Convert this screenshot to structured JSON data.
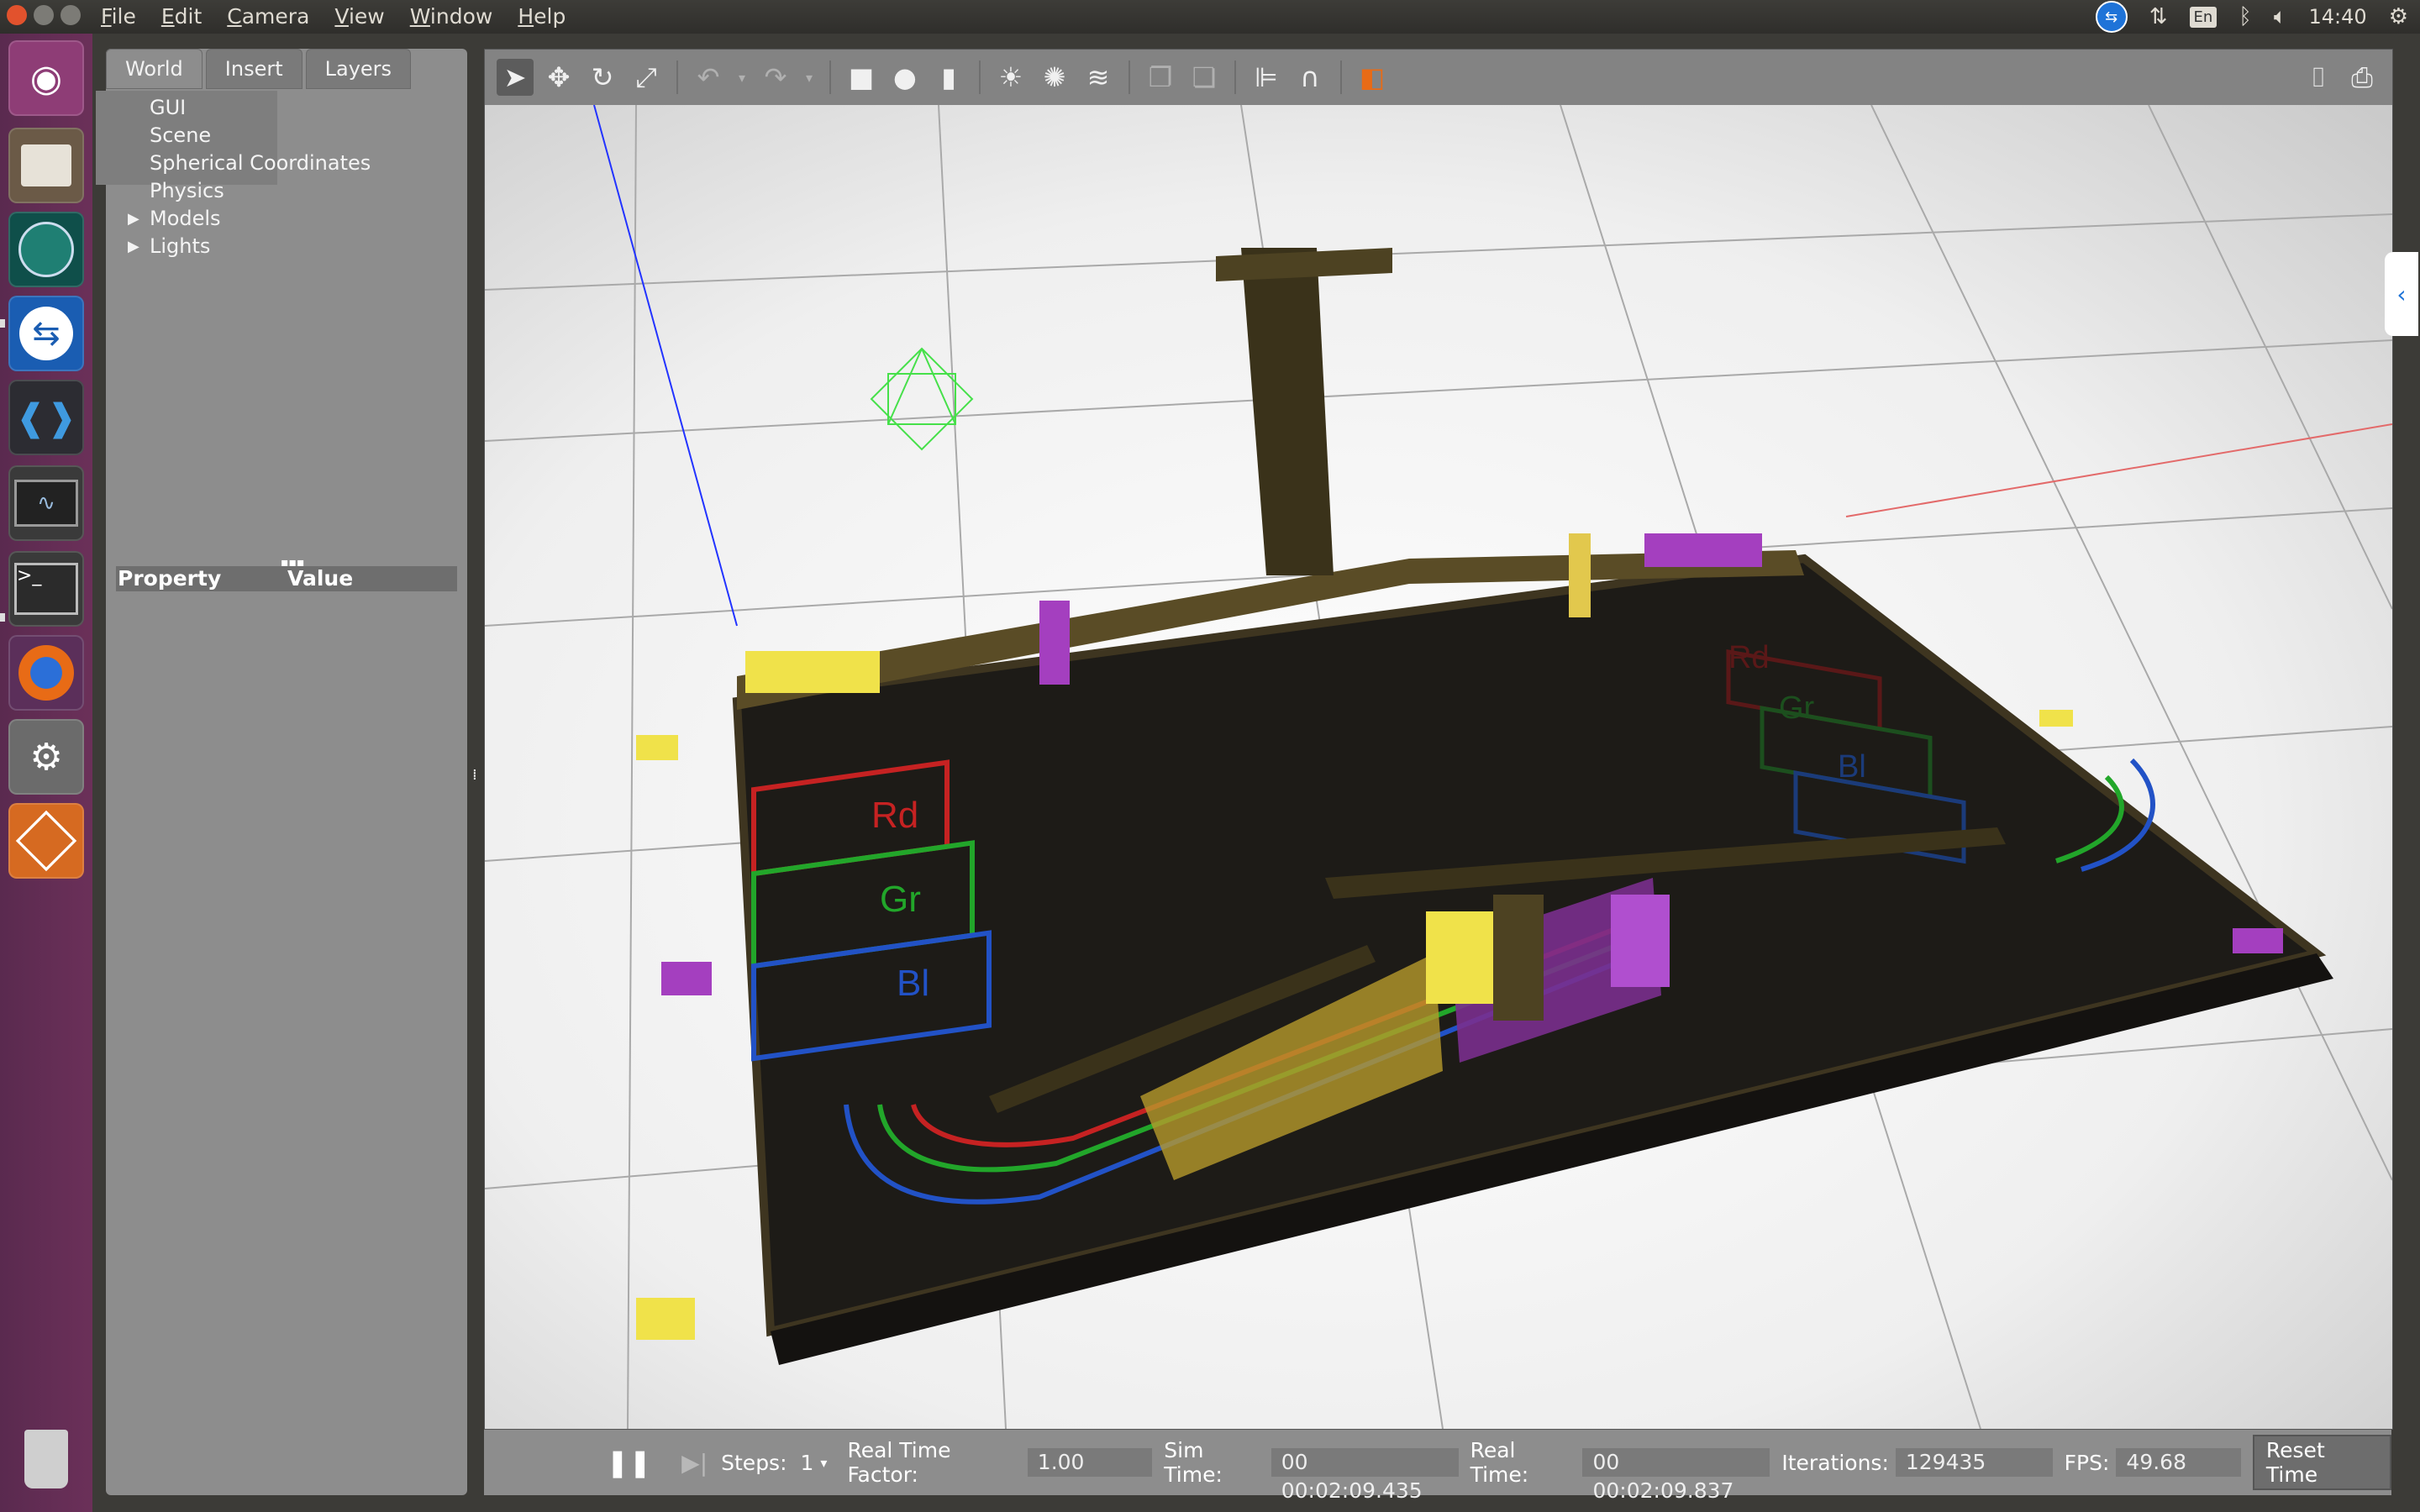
{
  "menubar": {
    "items": [
      {
        "label": "File",
        "key": "F",
        "rest": "ile"
      },
      {
        "label": "Edit",
        "key": "E",
        "rest": "dit"
      },
      {
        "label": "Camera",
        "key": "C",
        "rest": "amera"
      },
      {
        "label": "View",
        "key": "V",
        "rest": "iew"
      },
      {
        "label": "Window",
        "key": "W",
        "rest": "indow"
      },
      {
        "label": "Help",
        "key": "H",
        "rest": "elp"
      }
    ]
  },
  "tray": {
    "lang": "En",
    "time": "14:40"
  },
  "launcher": {
    "items": [
      "ubuntu-dash",
      "files",
      "gitkraken",
      "teamviewer",
      "vscode",
      "system-monitor",
      "terminal",
      "firefox",
      "system-settings",
      "gazebo"
    ]
  },
  "left_panel": {
    "tabs": [
      "World",
      "Insert",
      "Layers"
    ],
    "active_tab": "World",
    "tree": [
      {
        "label": "GUI",
        "expandable": false
      },
      {
        "label": "Scene",
        "expandable": false
      },
      {
        "label": "Spherical Coordinates",
        "expandable": false
      },
      {
        "label": "Physics",
        "expandable": false
      },
      {
        "label": "Models",
        "expandable": true
      },
      {
        "label": "Lights",
        "expandable": true
      }
    ],
    "property_header": {
      "property": "Property",
      "value": "Value"
    }
  },
  "scene_labels": {
    "left_red": "Rd",
    "left_green": "Gr",
    "left_blue": "Bl",
    "right_red": "Rd",
    "right_green": "Gr",
    "right_blue": "Bl"
  },
  "bottom_bar": {
    "steps_label": "Steps:",
    "steps_value": "1",
    "rtf_label": "Real Time Factor:",
    "rtf_value": "1.00",
    "sim_time_label": "Sim Time:",
    "sim_time_value": "00 00:02:09.435",
    "real_time_label": "Real Time:",
    "real_time_value": "00 00:02:09.837",
    "iterations_label": "Iterations:",
    "iterations_value": "129435",
    "fps_label": "FPS:",
    "fps_value": "49.68",
    "reset_label": "Reset Time"
  },
  "colors": {
    "launcher": "#6b3059",
    "accent": "#1e73d8",
    "board": "#1d1b17",
    "frame": "#4b4020",
    "yellow": "#f0e24a",
    "purple": "#a43fbf"
  }
}
